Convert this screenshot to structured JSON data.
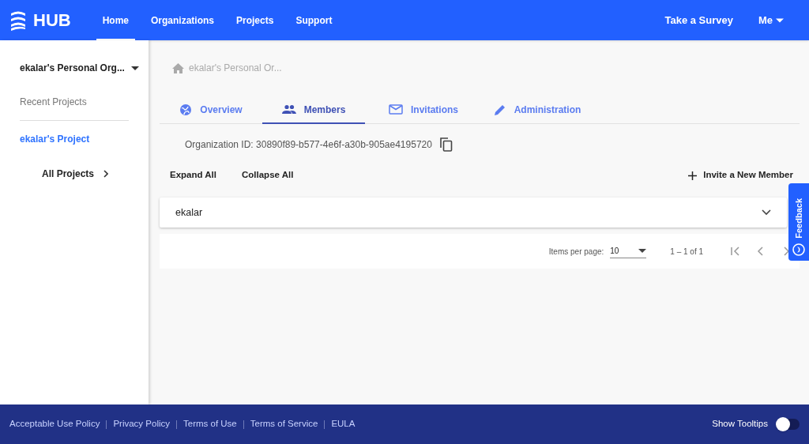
{
  "header": {
    "logo": "HUB",
    "nav": [
      {
        "label": "Home",
        "selected": true
      },
      {
        "label": "Organizations",
        "selected": false
      },
      {
        "label": "Projects",
        "selected": false
      },
      {
        "label": "Support",
        "selected": false
      }
    ],
    "survey": "Take a Survey",
    "user": "Me"
  },
  "sidebar": {
    "org": "ekalar's Personal Org...",
    "recent_label": "Recent Projects",
    "projects": [
      {
        "label": "ekalar's Project"
      }
    ],
    "all_projects": "All Projects"
  },
  "breadcrumb": "ekalar's Personal Or...",
  "tabs": [
    {
      "label": "Overview",
      "selected": false
    },
    {
      "label": "Members",
      "selected": true
    },
    {
      "label": "Invitations",
      "selected": false
    },
    {
      "label": "Administration",
      "selected": false
    }
  ],
  "org_id": "Organization ID: 30890f89-b577-4e6f-a30b-905ae4195720",
  "actions": {
    "expand": "Expand All",
    "collapse": "Collapse All",
    "invite": "Invite a New Member"
  },
  "members": [
    {
      "name": "ekalar",
      "expanded": false
    }
  ],
  "paginator": {
    "label": "Items per page:",
    "page_size": "10",
    "range": "1 – 1 of 1"
  },
  "feedback": "Feedback",
  "footer": {
    "links": [
      "Acceptable Use Policy",
      "Privacy Policy",
      "Terms of Use",
      "Terms of Service",
      "EULA"
    ],
    "tooltips_label": "Show Tooltips",
    "tooltips_on": false
  }
}
